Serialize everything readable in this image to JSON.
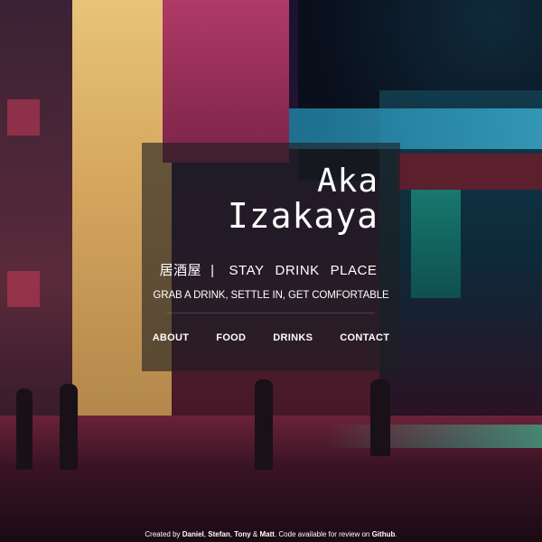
{
  "brand": {
    "line1": "Aka",
    "line2": "Izakaya"
  },
  "tagline": {
    "jp": "居酒屋",
    "separator": "|",
    "words": [
      "STAY",
      "DRINK",
      "PLACE"
    ]
  },
  "subline": "GRAB A DRINK, SETTLE IN, GET COMFORTABLE",
  "nav": [
    "ABOUT",
    "FOOD",
    "DRINKS",
    "CONTACT"
  ],
  "footer": {
    "prefix": "Created by",
    "names": [
      "Daniel",
      "Stefan",
      "Tony",
      "Matt"
    ],
    "comma": ",",
    "amp": "&",
    "suffix": ". Code available for review on",
    "link": "Github",
    "end": "."
  },
  "colors": {
    "panel": "#1e1e22",
    "text": "#ffffff"
  }
}
